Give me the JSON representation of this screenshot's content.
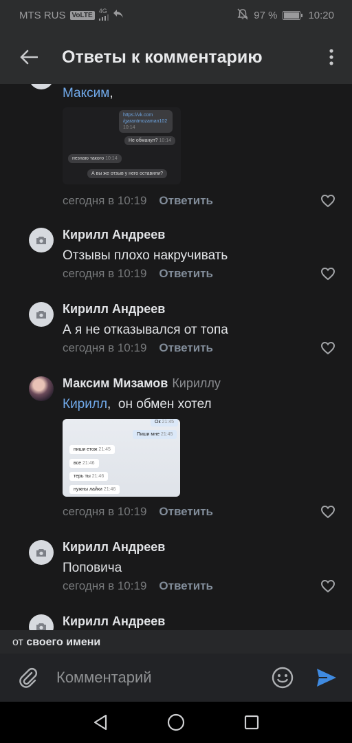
{
  "status_bar": {
    "carrier": "MTS RUS",
    "volte": "VoLTE",
    "network": "4G",
    "battery_percent": "97 %",
    "battery_level": 0.97,
    "time": "10:20"
  },
  "header": {
    "title": "Ответы к комментарию"
  },
  "comments": [
    {
      "mention": "Максим",
      "text": ",",
      "time": "сегодня в 10:19",
      "reply_label": "Ответить",
      "attachment": {
        "bubbles": [
          "https://vk.com /garantmozaman102",
          "Не обманул?",
          "незнаю такого",
          "А вы же отзыв у него оставили?"
        ],
        "times": [
          "10:14",
          "10:14",
          "10:14"
        ]
      }
    },
    {
      "author": "Кирилл Андреев",
      "text": "Отзывы плохо накручивать",
      "time": "сегодня в 10:19",
      "reply_label": "Ответить"
    },
    {
      "author": "Кирилл Андреев",
      "text": "А я не отказывался от топа",
      "time": "сегодня в 10:19",
      "reply_label": "Ответить"
    },
    {
      "author": "Максим Мизамов",
      "reply_to": "Кириллу",
      "mention": "Кирилл",
      "text": ",  он обмен хотел",
      "time": "сегодня в 10:19",
      "reply_label": "Ответить",
      "attachment": {
        "bubbles": [
          "Ок",
          "Пиши мне",
          "пиши етож",
          "все",
          "терь ты",
          "нужны лайки"
        ],
        "times": [
          "21:45",
          "21:45",
          "21:45",
          "21:46",
          "21:46",
          "21:46"
        ]
      }
    },
    {
      "author": "Кирилл Андреев",
      "text": "Поповича",
      "time": "сегодня в 10:19",
      "reply_label": "Ответить"
    },
    {
      "author": "Кирилл Андреев"
    }
  ],
  "sender_bar": {
    "prefix": "от",
    "name": "своего имени"
  },
  "composer": {
    "placeholder": "Комментарий"
  },
  "colors": {
    "accent": "#71aaeb",
    "send": "#3f8ae0",
    "background": "#19191a"
  }
}
